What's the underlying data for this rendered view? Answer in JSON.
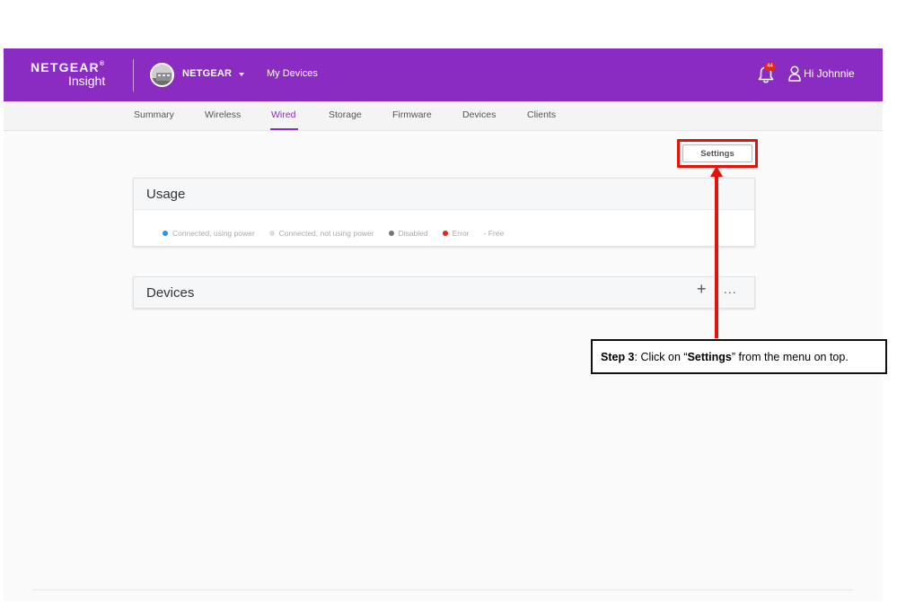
{
  "header": {
    "brand": "NETGEAR",
    "brand_mark": "®",
    "product": "Insight",
    "org_name": "NETGEAR",
    "my_devices_label": "My Devices",
    "notification_count": "44",
    "user_greeting": "Hi Johnnie",
    "accent_color": "#8a2bc2"
  },
  "subnav": {
    "tabs": [
      {
        "label": "Summary"
      },
      {
        "label": "Wireless"
      },
      {
        "label": "Wired",
        "active": true
      },
      {
        "label": "Storage"
      },
      {
        "label": "Firmware"
      },
      {
        "label": "Devices"
      },
      {
        "label": "Clients"
      }
    ]
  },
  "toolbar": {
    "settings_label": "Settings"
  },
  "usage": {
    "title": "Usage",
    "legend": [
      {
        "label": "Connected, using power",
        "color": "#2196f3"
      },
      {
        "label": "Connected, not using power",
        "color": "#dddddd"
      },
      {
        "label": "Disabled",
        "color": "#777777"
      },
      {
        "label": "Error",
        "color": "#e0281c"
      },
      {
        "label": "- Free"
      }
    ]
  },
  "devices": {
    "title": "Devices",
    "add_symbol": "+",
    "more_symbol": "..."
  },
  "annotation": {
    "step": "Step 3",
    "text_before": ": Click on “",
    "highlight": "Settings",
    "text_after": "” from the menu on top.",
    "color": "#e3120b"
  }
}
